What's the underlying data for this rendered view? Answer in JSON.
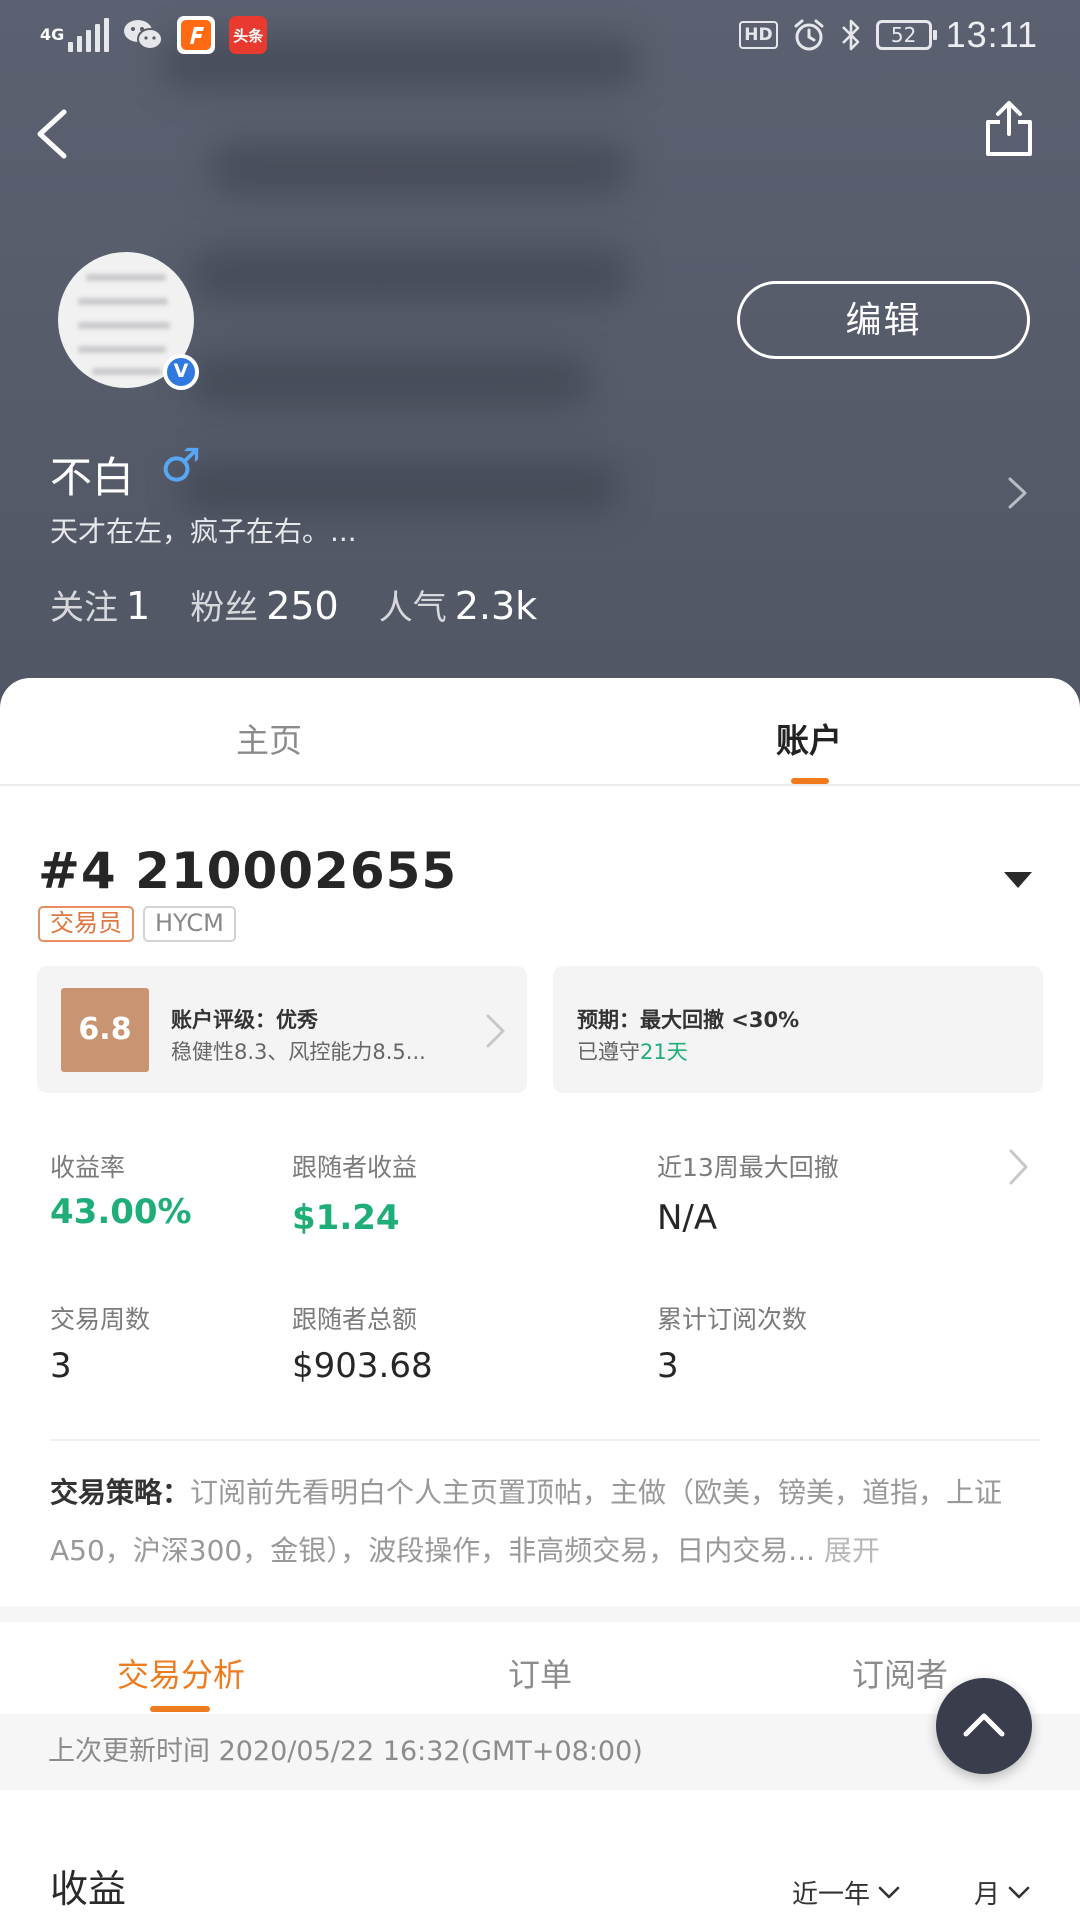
{
  "status_bar": {
    "network": "4G",
    "app_toutiao": "头条",
    "hd": "HD",
    "battery": "52",
    "time": "13:11"
  },
  "header": {
    "edit_label": "编辑",
    "name": "不白",
    "gender_symbol": "♂",
    "bio": "天才在左，疯子在右。...",
    "verified_mark": "V",
    "stats": {
      "following_label": "关注",
      "following_value": "1",
      "fans_label": "粉丝",
      "fans_value": "250",
      "popularity_label": "人气",
      "popularity_value": "2.3k"
    }
  },
  "tabs": [
    {
      "label": "主页",
      "active": false
    },
    {
      "label": "账户",
      "active": true
    }
  ],
  "account": {
    "id_text": "#4 210002655",
    "tag_trader": "交易员",
    "tag_broker": "HYCM",
    "rating": {
      "score": "6.8",
      "title": "账户评级：优秀",
      "detail": "稳健性8.3、风控能力8.5..."
    },
    "expectation": {
      "title": "预期：最大回撤 <30%",
      "kept_prefix": "已遵守",
      "kept_days": "21天"
    },
    "metrics": [
      {
        "label": "收益率",
        "value": "43.00%"
      },
      {
        "label": "跟随者收益",
        "value": "$1.24"
      },
      {
        "label": "近13周最大回撤",
        "value": "N/A"
      },
      {
        "label": "交易周数",
        "value": "3"
      },
      {
        "label": "跟随者总额",
        "value": "$903.68"
      },
      {
        "label": "累计订阅次数",
        "value": "3"
      }
    ],
    "strategy": {
      "label": "交易策略：",
      "text": "订阅前先看明白个人主页置顶帖，主做（欧美，镑美，道指，上证A50，沪深300，金银），波段操作，非高频交易，日内交易...",
      "expand": "展开"
    }
  },
  "analysis_tabs": [
    {
      "label": "交易分析",
      "active": true
    },
    {
      "label": "订单",
      "active": false
    },
    {
      "label": "订阅者",
      "active": false
    }
  ],
  "last_update": "上次更新时间 2020/05/22 16:32(GMT+08:00)",
  "income": {
    "title": "收益",
    "range_select": "近一年",
    "unit_select": "月"
  },
  "colors": {
    "accent_orange": "#ef7b1f",
    "positive_green": "#1fae78",
    "rating_tan": "#c99472",
    "header_bg": "#565c6a"
  }
}
